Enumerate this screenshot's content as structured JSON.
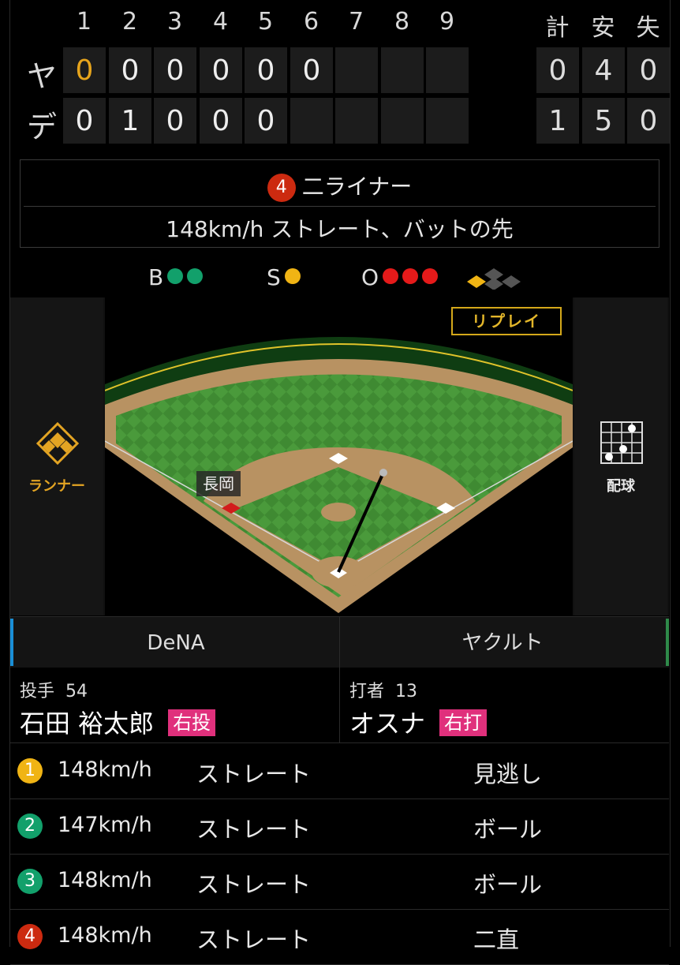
{
  "scoreboard": {
    "innings": [
      "1",
      "2",
      "3",
      "4",
      "5",
      "6",
      "7",
      "8",
      "9"
    ],
    "total_headers": [
      "計",
      "安",
      "失"
    ],
    "teams": [
      {
        "abbr": "ヤ",
        "scores": [
          "0",
          "0",
          "0",
          "0",
          "0",
          "0",
          "",
          "",
          ""
        ],
        "totals": [
          "0",
          "4",
          "0"
        ]
      },
      {
        "abbr": "デ",
        "scores": [
          "0",
          "1",
          "0",
          "0",
          "0",
          "",
          "",
          "",
          ""
        ],
        "totals": [
          "1",
          "5",
          "0"
        ]
      }
    ]
  },
  "play": {
    "number": "4",
    "result": "二ライナー",
    "description": "148km/h ストレート、バットの先"
  },
  "count": {
    "b_label": "B",
    "s_label": "S",
    "o_label": "O",
    "balls": 2,
    "strikes": 1,
    "outs": 3,
    "ball_color": "#12a06b",
    "strike_color": "#f0b414",
    "out_color": "#e51a1a"
  },
  "field": {
    "replay_label": "リプレイ",
    "runner_button_label": "ランナー",
    "pitch_button_label": "配球",
    "runner_name": "長岡"
  },
  "teams_header": {
    "left": "DeNA",
    "right": "ヤクルト",
    "left_color": "#1a8fd6",
    "right_color": "#2f8a4a"
  },
  "pitcher": {
    "role": "投手",
    "number": "54",
    "name": "石田 裕太郎",
    "hand": "右投"
  },
  "batter": {
    "role": "打者",
    "number": "13",
    "name": "オスナ",
    "hand": "右打"
  },
  "pitches": [
    {
      "n": "1",
      "speed": "148km/h",
      "type": "ストレート",
      "result": "見逃し",
      "color": "#f0b414"
    },
    {
      "n": "2",
      "speed": "147km/h",
      "type": "ストレート",
      "result": "ボール",
      "color": "#12a06b"
    },
    {
      "n": "3",
      "speed": "148km/h",
      "type": "ストレート",
      "result": "ボール",
      "color": "#12a06b"
    },
    {
      "n": "4",
      "speed": "148km/h",
      "type": "ストレート",
      "result": "二直",
      "color": "#cc2a10"
    }
  ]
}
